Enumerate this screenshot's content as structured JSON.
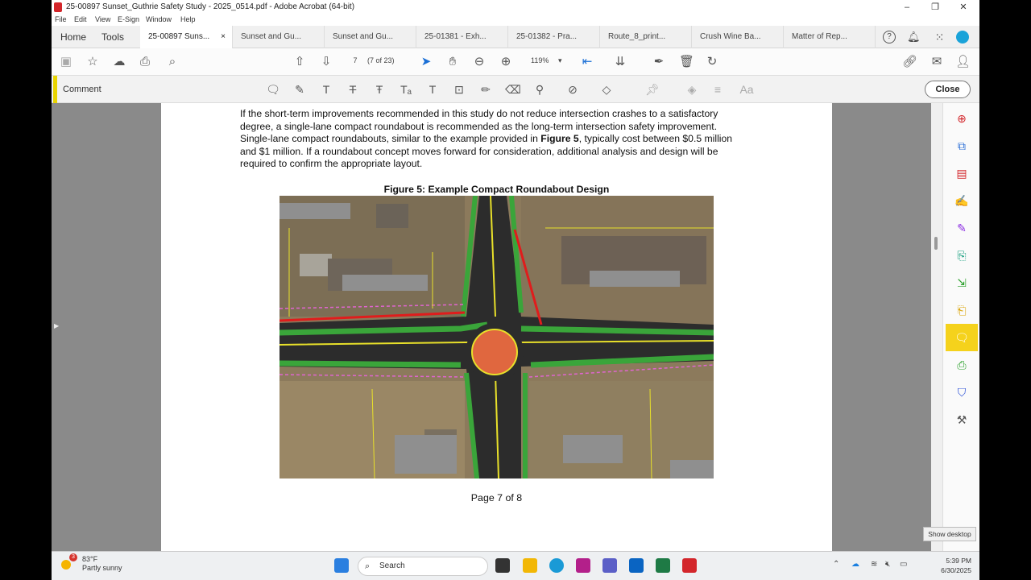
{
  "window": {
    "title": "25-00897 Sunset_Guthrie Safety Study - 2025_0514.pdf - Adobe Acrobat (64-bit)",
    "menu": [
      "File",
      "Edit",
      "View",
      "E-Sign",
      "Window",
      "Help"
    ]
  },
  "tabs": {
    "home": "Home",
    "tools": "Tools",
    "docs": [
      {
        "label": "25-00897 Suns..."
      },
      {
        "label": "Sunset and Gu..."
      },
      {
        "label": "Sunset and Gu..."
      },
      {
        "label": "25-01381 - Exh..."
      },
      {
        "label": "25-01382 - Pra..."
      },
      {
        "label": "Route_8_print..."
      },
      {
        "label": "Crush Wine Ba..."
      },
      {
        "label": "Matter of Rep..."
      }
    ],
    "close_glyph": "×"
  },
  "toolbar": {
    "page_input": "7",
    "page_count": "(7 of 23)",
    "zoom": "119%"
  },
  "comment_bar": {
    "label": "Comment",
    "close": "Close",
    "aa": "Aa"
  },
  "document": {
    "paragraph_before": "If the short-term improvements recommended in this study do not reduce intersection crashes to a satisfactory degree, a single-lane compact roundabout is recommended as the long-term intersection safety improvement. Single-lane compact roundabouts, similar to the example provided in ",
    "paragraph_bold": "Figure 5",
    "paragraph_after": ", typically cost between $0.5 million and $1 million. If a roundabout concept moves forward for consideration, additional analysis and design will be required to confirm the appropriate layout.",
    "figure_title": "Figure 5: Example Compact Roundabout Design",
    "page_footer": "Page 7 of 8"
  },
  "tooltip": "Show desktop",
  "taskbar": {
    "weather_temp": "83°F",
    "weather_desc": "Partly sunny",
    "weather_badge": "3",
    "search": "Search",
    "time": "5:39 PM",
    "date": "6/30/2025"
  },
  "colors": {
    "acrobat_red": "#d3262b",
    "comment_yellow": "#e8d400",
    "roadway": "#262626",
    "median_green": "#3aa53a",
    "roundabout_center": "#e0673f"
  }
}
